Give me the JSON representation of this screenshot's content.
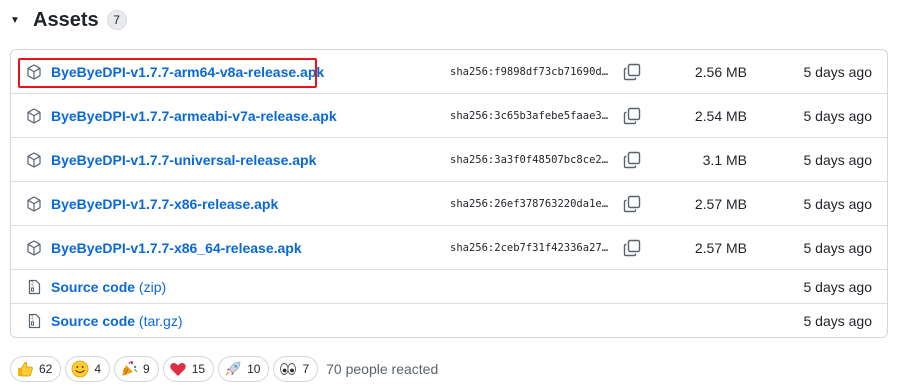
{
  "header": {
    "title": "Assets",
    "count": "7",
    "toggle": "▼"
  },
  "assets": [
    {
      "name": "ByeByeDPI-v1.7.7-arm64-v8a-release.apk",
      "sha": "sha256:f9898df73cb71690d…",
      "size": "2.56 MB",
      "time": "5 days ago"
    },
    {
      "name": "ByeByeDPI-v1.7.7-armeabi-v7a-release.apk",
      "sha": "sha256:3c65b3afebe5faae3…",
      "size": "2.54 MB",
      "time": "5 days ago"
    },
    {
      "name": "ByeByeDPI-v1.7.7-universal-release.apk",
      "sha": "sha256:3a3f0f48507bc8ce2…",
      "size": "3.1 MB",
      "time": "5 days ago"
    },
    {
      "name": "ByeByeDPI-v1.7.7-x86-release.apk",
      "sha": "sha256:26ef378763220da1e…",
      "size": "2.57 MB",
      "time": "5 days ago"
    },
    {
      "name": "ByeByeDPI-v1.7.7-x86_64-release.apk",
      "sha": "sha256:2ceb7f31f42336a27…",
      "size": "2.57 MB",
      "time": "5 days ago"
    }
  ],
  "source": [
    {
      "label": "Source code",
      "ext": "(zip)",
      "time": "5 days ago"
    },
    {
      "label": "Source code",
      "ext": "(tar.gz)",
      "time": "5 days ago"
    }
  ],
  "reactions": [
    {
      "icon": "thumbs-up-icon",
      "count": "62"
    },
    {
      "icon": "smile-icon",
      "count": "4"
    },
    {
      "icon": "party-popper-icon",
      "count": "9"
    },
    {
      "icon": "heart-icon",
      "count": "15"
    },
    {
      "icon": "rocket-icon",
      "count": "10"
    },
    {
      "icon": "eyes-icon",
      "count": "7"
    }
  ],
  "reacted_text": "70 people reacted",
  "colors": {
    "link": "#0969da",
    "border": "#d0d7de",
    "highlight": "#e8131b"
  }
}
